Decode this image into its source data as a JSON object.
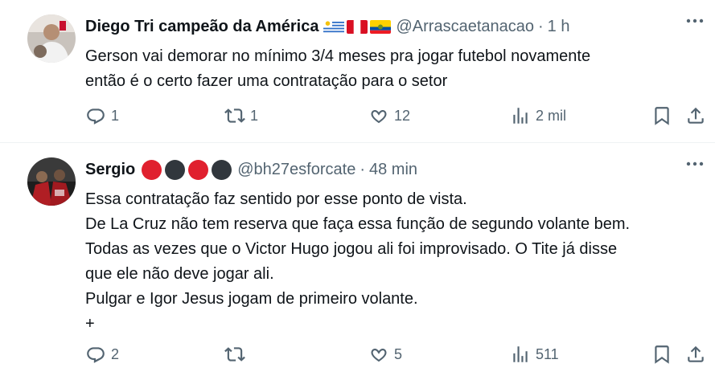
{
  "tweets": [
    {
      "display_name": "Diego Tri campeão da América",
      "handle": "@Arrascaetanacao",
      "separator": "·",
      "time": "1 h",
      "badges": [
        "uruguay-flag",
        "peru-flag",
        "ecuador-flag"
      ],
      "text": "Gerson vai demorar no mínimo 3/4 meses pra jogar futebol novamente\nentão é o certo fazer uma contratação para o setor",
      "replies": "1",
      "reposts": "1",
      "likes": "12",
      "views": "2 mil"
    },
    {
      "display_name": "Sergio",
      "handle": "@bh27esforcate",
      "separator": "·",
      "time": "48 min",
      "badges": [
        "red-circle",
        "black-circle",
        "red-circle",
        "black-circle"
      ],
      "text": "Essa contratação faz sentido por esse ponto de vista.\nDe La Cruz não tem reserva que faça essa função de segundo volante bem.\nTodas as vezes que o Victor Hugo jogou ali foi improvisado. O Tite já disse\nque ele não deve jogar ali.\nPulgar e Igor Jesus jogam de primeiro volante.\n+",
      "replies": "2",
      "reposts": "",
      "likes": "5",
      "views": "511"
    }
  ],
  "colors": {
    "text": "#0f1419",
    "secondary": "#536471",
    "divider": "#eff3f4",
    "red_circle": "#e0202e",
    "black_circle": "#31373d"
  }
}
